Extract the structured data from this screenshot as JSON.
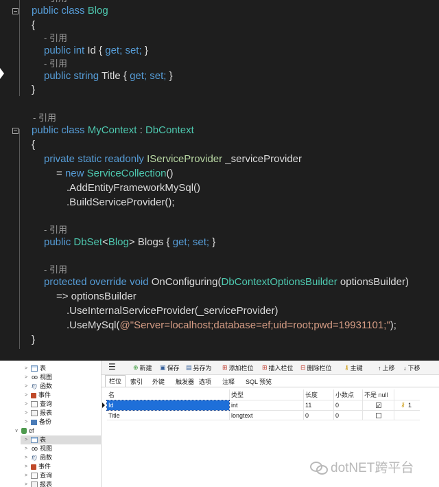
{
  "editor": {
    "ref_label": "引用",
    "ref_label_dash": "- 引用",
    "blog_class": {
      "keyword": "public class",
      "name": "Blog"
    },
    "brace_open": "{",
    "brace_close": "}",
    "id_prop": {
      "mods": "public int",
      "name": "Id",
      "accessors_open": "{",
      "get": "get;",
      "set": "set;",
      "accessors_close": "}"
    },
    "title_prop": {
      "mods": "public string",
      "name": "Title",
      "accessors_open": "{",
      "get": "get;",
      "set": "set;",
      "accessors_close": "}"
    },
    "context_class": {
      "keyword": "public class",
      "name": "MyContext",
      "sep": ":",
      "base": "DbContext"
    },
    "provider_field": {
      "mods": "private static readonly",
      "type": "IServiceProvider",
      "name": "_serviceProvider"
    },
    "provider_init": {
      "op": "=",
      "new_kw": "new",
      "type": "ServiceCollection",
      "call": "()"
    },
    "chain1": ".AddEntityFrameworkMySql()",
    "chain2": ".BuildServiceProvider();",
    "blogs_prop": {
      "mods": "public",
      "type": "DbSet",
      "lt": "<",
      "arg": "Blog",
      "gt": ">",
      "name": "Blogs",
      "accessors_open": "{",
      "get": "get;",
      "set": "set;",
      "accessors_close": "}"
    },
    "on_configuring": {
      "mods": "protected override void",
      "name": "OnConfiguring(",
      "param_type": "DbContextOptionsBuilder",
      "param_name": "optionsBuilder)"
    },
    "lambda_line": "=> optionsBuilder",
    "chain3": ".UseInternalServiceProvider(_serviceProvider)",
    "chain4_pre": ".UseMySql(",
    "chain4_str": "@\"Server=localhost;database=ef;uid=root;pwd=19931101;\"",
    "chain4_post": ");"
  },
  "tree": {
    "items": [
      {
        "label": "表",
        "icon": "table-icon"
      },
      {
        "label": "视图",
        "icon": "view-icon"
      },
      {
        "label": "函数",
        "icon": "function-icon"
      },
      {
        "label": "事件",
        "icon": "event-icon"
      },
      {
        "label": "查询",
        "icon": "query-icon"
      },
      {
        "label": "报表",
        "icon": "report-icon"
      },
      {
        "label": "备份",
        "icon": "backup-icon"
      },
      {
        "label": "ef",
        "icon": "database-icon"
      },
      {
        "label": "表",
        "icon": "table-icon"
      },
      {
        "label": "视图",
        "icon": "view-icon"
      },
      {
        "label": "函数",
        "icon": "function-icon"
      },
      {
        "label": "事件",
        "icon": "event-icon"
      },
      {
        "label": "查询",
        "icon": "query-icon"
      },
      {
        "label": "报表",
        "icon": "report-icon"
      }
    ]
  },
  "toolbar": {
    "menu_glyph": "☰",
    "new": "新建",
    "save": "保存",
    "save_as": "另存为",
    "add_column": "添加栏位",
    "insert_column": "插入栏位",
    "delete_column": "删除栏位",
    "primary_key": "主键",
    "move_up": "上移",
    "move_down": "下移"
  },
  "tabs": [
    "栏位",
    "索引",
    "外键",
    "触发器",
    "选项",
    "注释",
    "SQL 预览"
  ],
  "grid": {
    "headers": {
      "name": "名",
      "type": "类型",
      "length": "长度",
      "decimals": "小数点",
      "not_null": "不是 null"
    },
    "rows": [
      {
        "name": "Id",
        "type": "int",
        "length": "11",
        "decimals": "0",
        "not_null": "✓",
        "key_num": "1"
      },
      {
        "name": "Title",
        "type": "longtext",
        "length": "0",
        "decimals": "0",
        "not_null": ""
      }
    ]
  },
  "watermark": {
    "text": "dotNET跨平台"
  }
}
